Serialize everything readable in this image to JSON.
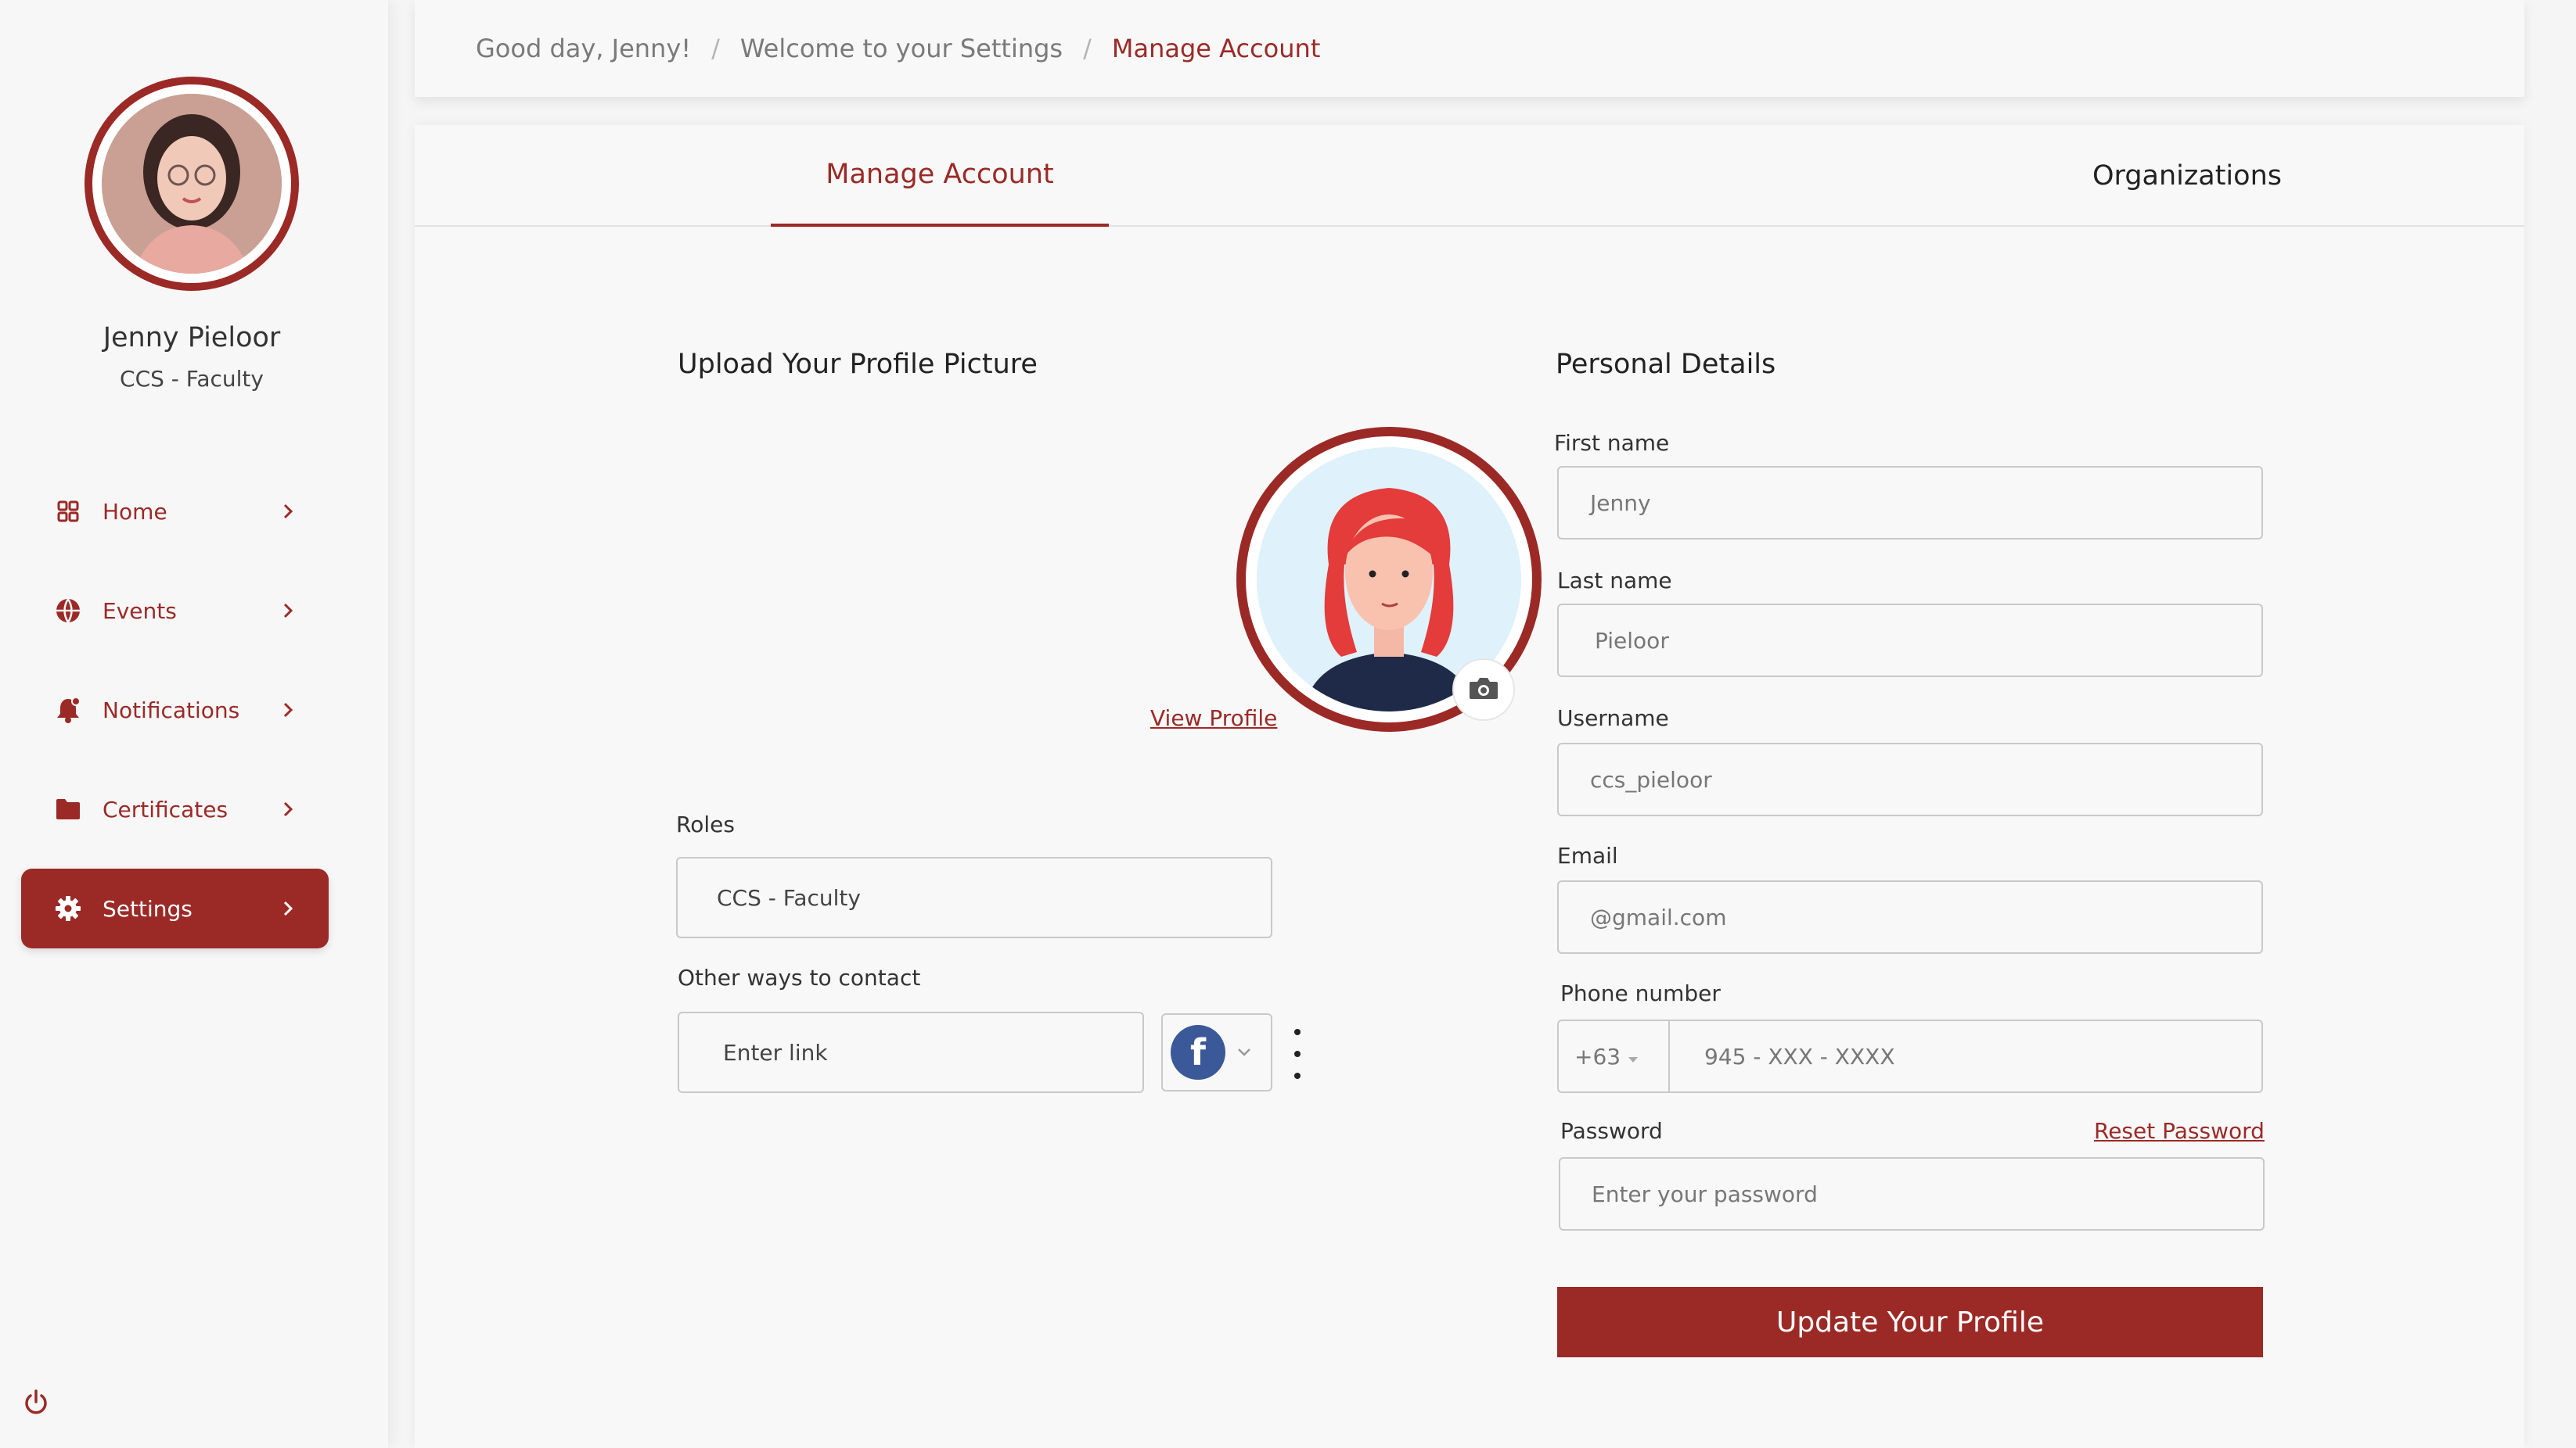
{
  "user": {
    "name": "Jenny Pieloor",
    "role": "CCS - Faculty"
  },
  "nav": {
    "items": [
      {
        "label": "Home",
        "icon": "grid-icon",
        "active": false
      },
      {
        "label": "Events",
        "icon": "globe-icon",
        "active": false
      },
      {
        "label": "Notifications",
        "icon": "bell-icon",
        "active": false
      },
      {
        "label": "Certificates",
        "icon": "folder-icon",
        "active": false
      },
      {
        "label": "Settings",
        "icon": "gear-icon",
        "active": true
      }
    ]
  },
  "breadcrumb": {
    "greeting": "Good day, Jenny!",
    "section": "Welcome to your Settings",
    "current": "Manage Account",
    "separator": "/"
  },
  "tabs": {
    "manage": "Manage Account",
    "orgs": "Organizations"
  },
  "profile": {
    "upload_title": "Upload Your Profile  Picture",
    "view_profile": "View Profile",
    "roles_label": "Roles",
    "roles_value": "CCS - Faculty",
    "contact_label": "Other ways to contact",
    "contact_placeholder": "Enter link",
    "contact_icon": "facebook-icon"
  },
  "details": {
    "title": "Personal Details",
    "first_name_label": "First name",
    "first_name_value": "Jenny",
    "last_name_label": "Last name",
    "last_name_value": "Pieloor",
    "username_label": "Username",
    "username_value": "ccs_pieloor",
    "email_label": "Email",
    "email_value": "@gmail.com",
    "phone_label": "Phone number",
    "phone_code": "+63",
    "phone_placeholder": "945 - XXX - XXXX",
    "password_label": "Password",
    "reset_password": "Reset Password",
    "password_placeholder": "Enter your password",
    "submit": "Update Your Profile"
  },
  "colors": {
    "accent": "#9b2a26",
    "facebook": "#3b5998"
  }
}
